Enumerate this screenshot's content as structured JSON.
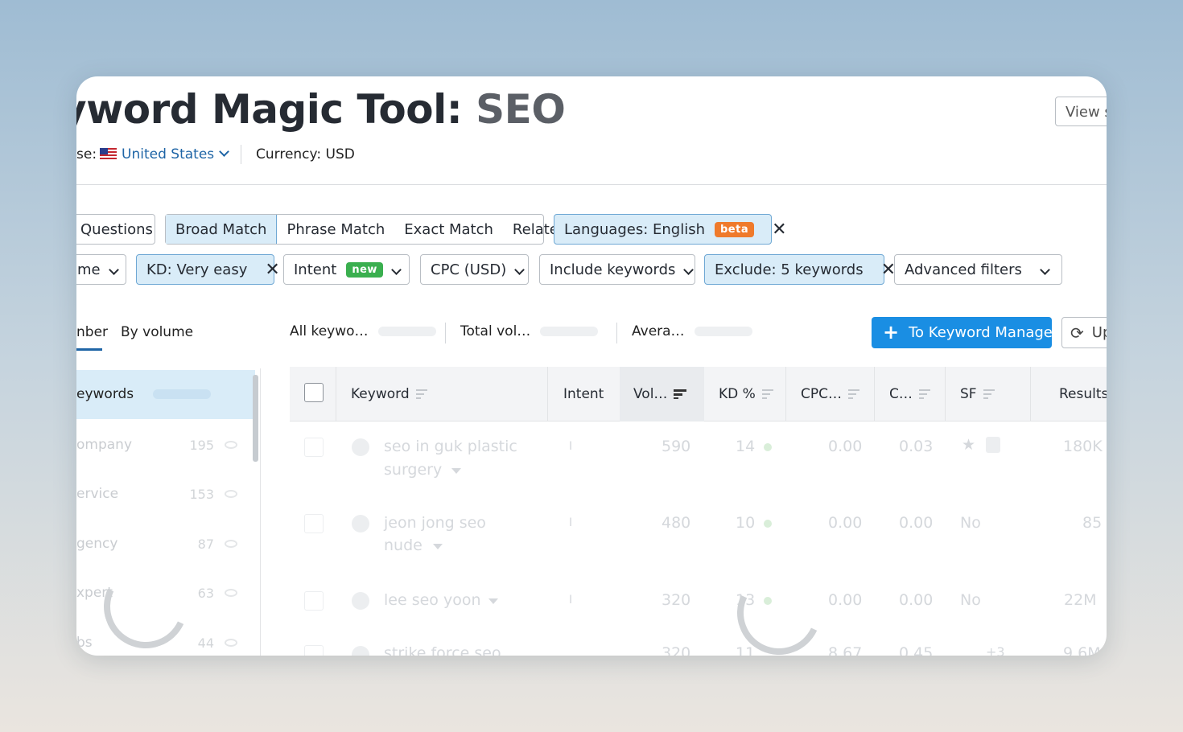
{
  "header": {
    "title_prefix": "yword Magic Tool: ",
    "title_query": "SEO",
    "view_button": "View s",
    "database_label": "se:",
    "database_value": "United States",
    "currency_label": "Currency:",
    "currency_value": "USD"
  },
  "match_tabs": [
    "Questions",
    "Broad Match",
    "Phrase Match",
    "Exact Match",
    "Related"
  ],
  "active_match": "Broad Match",
  "language_filter": {
    "label": "Languages: English",
    "badge": "beta"
  },
  "filters": {
    "first_partial": "me",
    "kd": "KD: Very easy",
    "intent": "Intent",
    "intent_badge": "new",
    "cpc": "CPC (USD)",
    "include": "Include keywords",
    "exclude": "Exclude: 5 keywords",
    "advanced": "Advanced filters"
  },
  "view_tabs": {
    "number": "nber",
    "volume": "By volume"
  },
  "stats": {
    "all_keywords": "All keywo…",
    "total_volume": "Total vol…",
    "average": "Avera…"
  },
  "actions": {
    "to_manager": "To Keyword Manager",
    "update": "Up"
  },
  "sidebar": {
    "header": "eywords",
    "items": [
      {
        "label": "ompany",
        "count": "195"
      },
      {
        "label": "ervice",
        "count": "153"
      },
      {
        "label": "gency",
        "count": "87"
      },
      {
        "label": "xpert",
        "count": "63"
      },
      {
        "label": "bs",
        "count": "44"
      }
    ]
  },
  "table": {
    "columns": [
      "Keyword",
      "Intent",
      "Vol…",
      "KD %",
      "CPC…",
      "C…",
      "SF",
      "Results"
    ],
    "rows": [
      {
        "keyword_line1": "seo in guk plastic",
        "keyword_line2": "surgery",
        "intent": "I",
        "volume": "590",
        "kd": "14",
        "cpc": "0.00",
        "com": "0.03",
        "sf": "",
        "results": "180K"
      },
      {
        "keyword_line1": "jeon jong seo",
        "keyword_line2": "nude",
        "intent": "I",
        "volume": "480",
        "kd": "10",
        "cpc": "0.00",
        "com": "0.00",
        "sf": "No",
        "results": "85"
      },
      {
        "keyword_line1": "lee seo yoon",
        "keyword_line2": "",
        "intent": "I",
        "volume": "320",
        "kd": "13",
        "cpc": "0.00",
        "com": "0.00",
        "sf": "No",
        "results": "22M"
      },
      {
        "keyword_line1": "strike force seo",
        "keyword_line2": "",
        "intent": "I",
        "volume": "320",
        "kd": "11",
        "cpc": "8.67",
        "com": "0.45",
        "sf": "+3",
        "results": "9.6M"
      }
    ]
  },
  "colors": {
    "accent": "#1a8ee3",
    "selected_bg": "#d9ecf8",
    "beta": "#ef7a2b",
    "new": "#3aaf4f",
    "link": "#1f65a6"
  }
}
